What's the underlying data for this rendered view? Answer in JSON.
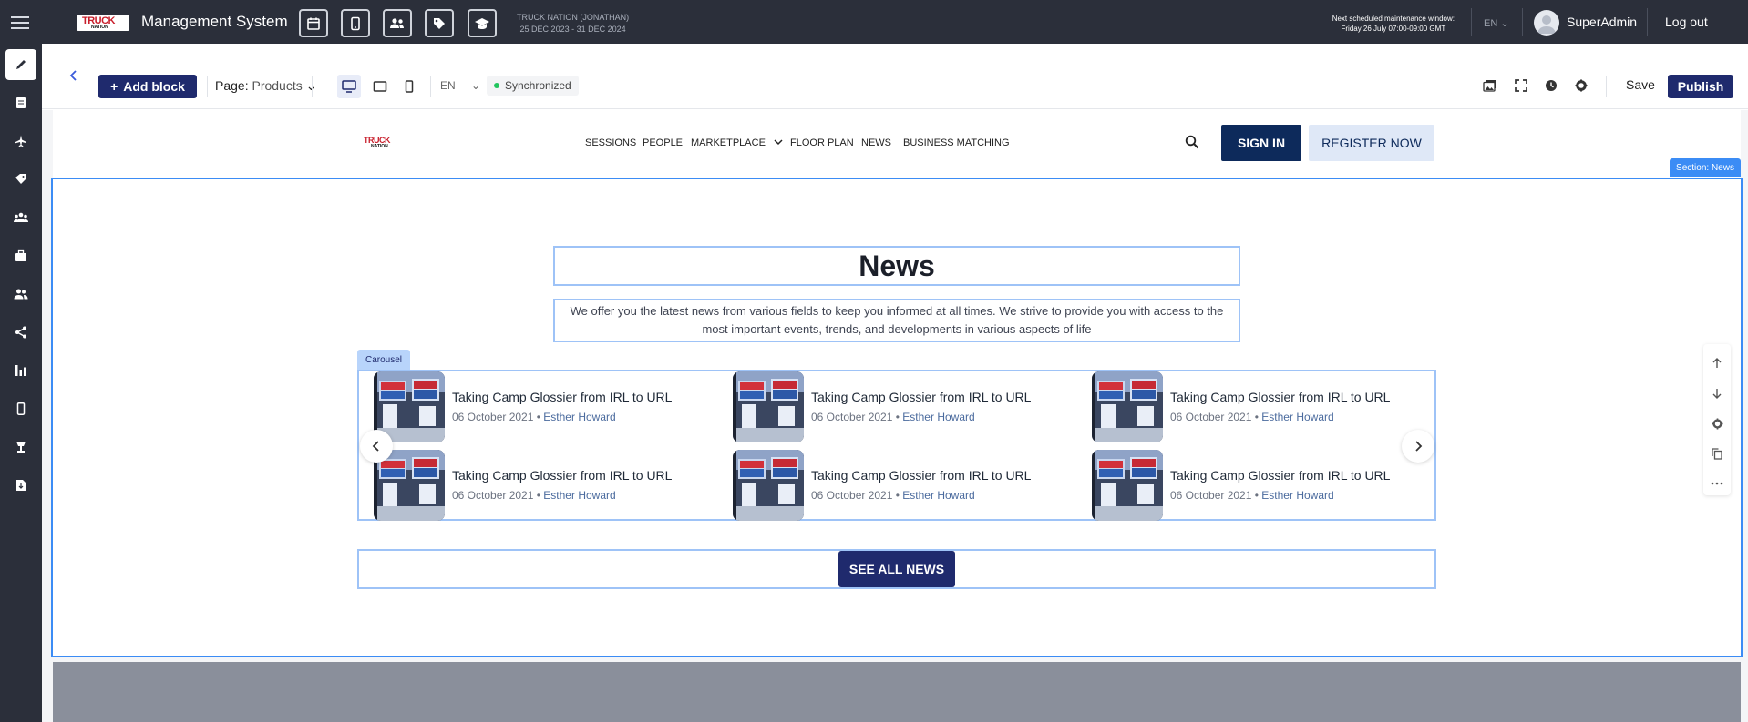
{
  "topbar": {
    "logo_line1": "TRUCK",
    "logo_line2": "NATION",
    "app_title": "Management System",
    "event_name": "TRUCK NATION (JONATHAN)",
    "event_dates": "25 DEC 2023 - 31 DEC 2024",
    "maintenance_title": "Next scheduled maintenance window:",
    "maintenance_time": "Friday 26 July 07:00-09:00 GMT",
    "language": "EN",
    "user_name": "SuperAdmin",
    "logout_label": "Log out",
    "quick_icons": [
      "calendar-icon",
      "mobile-icon",
      "users-icon",
      "tag-icon",
      "graduation-cap-icon"
    ]
  },
  "sidebar": {
    "items": [
      {
        "icon": "pencil-icon",
        "active": true
      },
      {
        "icon": "document-icon",
        "active": false
      },
      {
        "icon": "plane-icon",
        "active": false
      },
      {
        "icon": "tag-icon",
        "active": false
      },
      {
        "icon": "group-icon",
        "active": false
      },
      {
        "icon": "briefcase-icon",
        "active": false
      },
      {
        "icon": "people-icon",
        "active": false
      },
      {
        "icon": "share-icon",
        "active": false
      },
      {
        "icon": "bar-chart-icon",
        "active": false
      },
      {
        "icon": "mobile-icon",
        "active": false
      },
      {
        "icon": "lamp-icon",
        "active": false
      },
      {
        "icon": "file-export-icon",
        "active": false
      }
    ]
  },
  "toolbar": {
    "add_block_label": "Add block",
    "page_label": "Page:",
    "page_value": "Products",
    "language": "EN",
    "sync_status": "Synchronized",
    "save_label": "Save",
    "publish_label": "Publish"
  },
  "site": {
    "logo_line1": "TRUCK",
    "logo_line2": "NATION",
    "nav": [
      "SESSIONS",
      "PEOPLE",
      "MARKETPLACE",
      "FLOOR PLAN",
      "NEWS",
      "BUSINESS MATCHING"
    ],
    "signin_label": "SIGN IN",
    "register_label": "REGISTER NOW"
  },
  "section": {
    "tag": "Section: News",
    "title": "News",
    "description": "We offer you the latest news from various fields to keep you informed at all times. We strive to provide you with access to the most important events, trends, and developments in various aspects of life",
    "carousel_tag": "Carousel",
    "cards": [
      {
        "title": "Taking Camp Glossier from IRL to URL",
        "date": "06 October 2021",
        "author": "Esther Howard"
      },
      {
        "title": "Taking Camp Glossier from IRL to URL",
        "date": "06 October 2021",
        "author": "Esther Howard"
      },
      {
        "title": "Taking Camp Glossier from IRL to URL",
        "date": "06 October 2021",
        "author": "Esther Howard"
      },
      {
        "title": "Taking Camp Glossier from IRL to URL",
        "date": "06 October 2021",
        "author": "Esther Howard"
      },
      {
        "title": "Taking Camp Glossier from IRL to URL",
        "date": "06 October 2021",
        "author": "Esther Howard"
      },
      {
        "title": "Taking Camp Glossier from IRL to URL",
        "date": "06 October 2021",
        "author": "Esther Howard"
      }
    ],
    "meta_separator": "•",
    "see_all_label": "SEE ALL NEWS"
  },
  "colors": {
    "topbar": "#2b2f3a",
    "primary": "#1f2a6d",
    "selection": "#3b8cf5",
    "signin": "#0d2a5b"
  }
}
